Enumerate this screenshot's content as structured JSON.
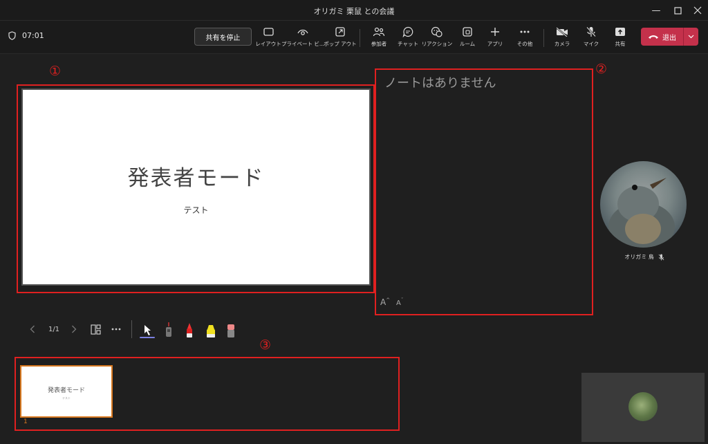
{
  "window": {
    "title": "オリガミ 栗鼠 との会議"
  },
  "toolbar": {
    "timer": "07:01",
    "stop_share_label": "共有を停止",
    "buttons": [
      {
        "label": "レイアウト",
        "icon": "layout-icon"
      },
      {
        "label": "プライベート ビ...",
        "icon": "eye-icon"
      },
      {
        "label": "ポップ アウト",
        "icon": "popout-icon"
      },
      {
        "label": "参加者",
        "icon": "people-icon"
      },
      {
        "label": "チャット",
        "icon": "chat-icon"
      },
      {
        "label": "リアクション",
        "icon": "reaction-icon"
      },
      {
        "label": "ルーム",
        "icon": "rooms-icon"
      },
      {
        "label": "アプリ",
        "icon": "plus-icon"
      },
      {
        "label": "その他",
        "icon": "more-icon"
      },
      {
        "label": "カメラ",
        "icon": "camera-off-icon"
      },
      {
        "label": "マイク",
        "icon": "mic-off-icon"
      },
      {
        "label": "共有",
        "icon": "share-icon"
      }
    ],
    "leave_label": "退出"
  },
  "annotations": [
    "①",
    "②",
    "③"
  ],
  "slide": {
    "title": "発表者モード",
    "subtitle": "テスト"
  },
  "notes": {
    "placeholder": "ノートはありません",
    "font_increase": "A",
    "font_decrease": "A"
  },
  "navigation": {
    "page": "1/1"
  },
  "thumbnails": [
    {
      "title": "発表者モード",
      "subtitle": "テスト",
      "number": "1"
    }
  ],
  "participant": {
    "name": "オリガミ 鳥"
  },
  "colors": {
    "annotation_red": "#e02020",
    "leave_red": "#c4314b",
    "thumb_orange": "#d8781f",
    "ink_accent": "#7b7fe0"
  }
}
